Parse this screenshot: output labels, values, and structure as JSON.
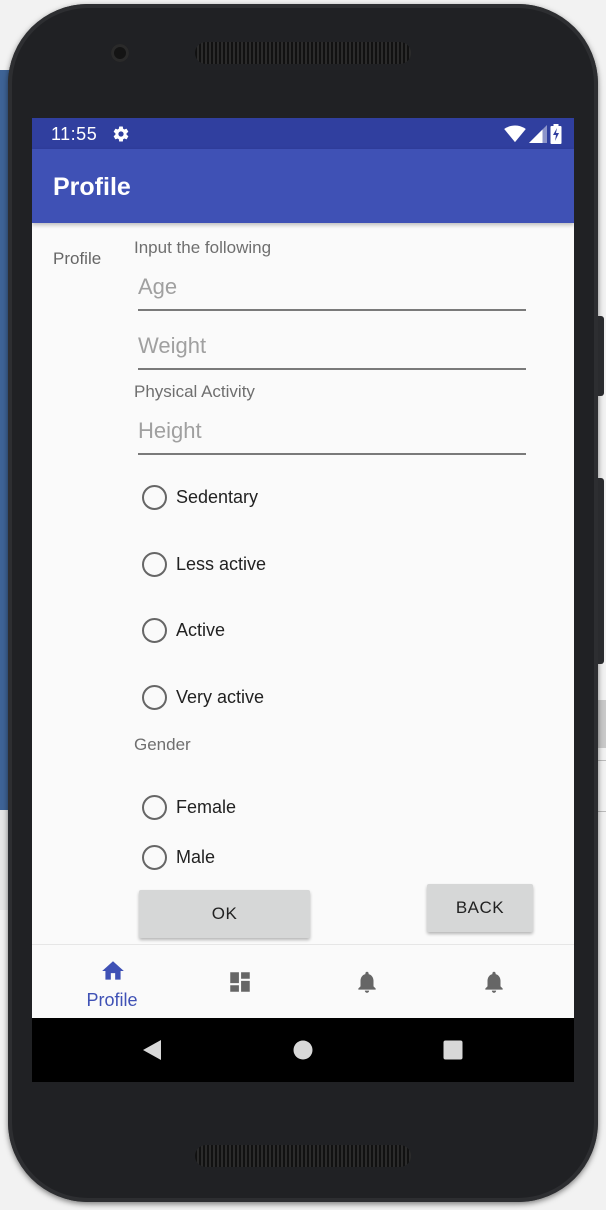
{
  "status_bar": {
    "time": "11:55"
  },
  "app_bar": {
    "title": "Profile"
  },
  "form": {
    "side_label": "Profile",
    "intro_label": "Input the following",
    "age_placeholder": "Age",
    "weight_placeholder": "Weight",
    "activity_label": "Physical Activity",
    "height_placeholder": "Height",
    "activity_options": [
      "Sedentary",
      "Less active",
      "Active",
      "Very active"
    ],
    "gender_label": "Gender",
    "gender_options": [
      "Female",
      "Male"
    ],
    "ok_label": "OK",
    "back_label": "BACK"
  },
  "bottom_nav": {
    "items": [
      {
        "label": "Profile",
        "icon": "home-icon",
        "active": true
      },
      {
        "label": "",
        "icon": "dashboard-icon",
        "active": false
      },
      {
        "label": "",
        "icon": "notifications-icon",
        "active": false
      },
      {
        "label": "",
        "icon": "notifications-icon",
        "active": false
      }
    ]
  },
  "colors": {
    "primary": "#3f51b5",
    "primary_dark": "#303f9f",
    "button": "#d6d7d7"
  }
}
